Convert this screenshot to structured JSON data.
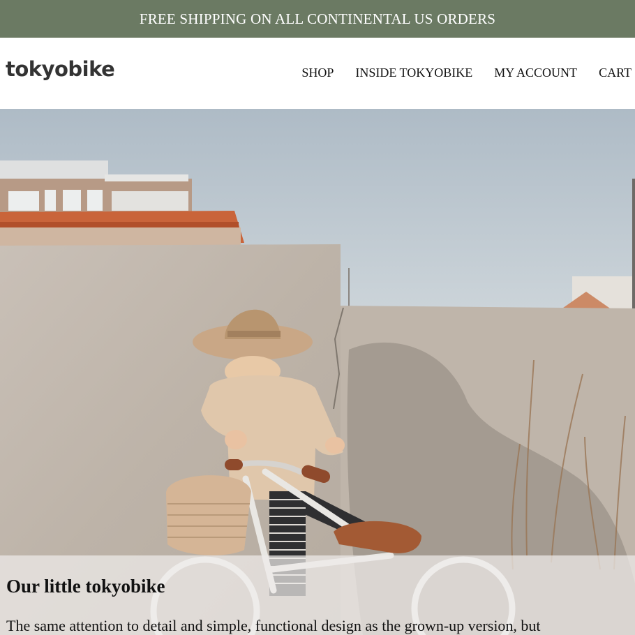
{
  "announcement": {
    "text": "FREE SHIPPING ON ALL CONTINENTAL US ORDERS"
  },
  "header": {
    "logo": "tokyobike",
    "nav": [
      "SHOP",
      "INSIDE TOKYOBIKE",
      "MY ACCOUNT",
      "CART"
    ]
  },
  "hero": {
    "title": "Our little tokyobike",
    "text": "The same attention to detail and simple, functional design as the grown-up version, but"
  },
  "colors": {
    "announcement_bg": "#6b7a63",
    "announcement_text": "#ffffff",
    "header_bg": "#ffffff"
  }
}
